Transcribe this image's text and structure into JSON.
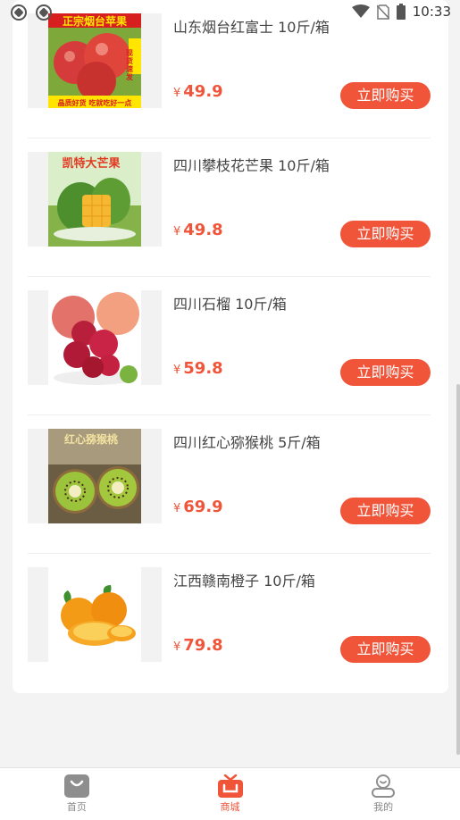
{
  "status_bar": {
    "time": "10:33",
    "icons": [
      "app-notification-icon",
      "app-notification-icon",
      "wifi-icon",
      "no-sim-icon",
      "battery-icon"
    ]
  },
  "colors": {
    "accent": "#f0553a",
    "card_bg": "#ffffff",
    "page_bg": "#f3f3f3"
  },
  "products": [
    {
      "title": "山东烟台红富士 10斤/箱",
      "currency": "¥",
      "price": "49.9",
      "buy_label": "立即购买",
      "image": {
        "banner": "正宗烟台苹果",
        "side": "现货速发",
        "footer": "晶质好货 吃就吃好一点"
      }
    },
    {
      "title": "四川攀枝花芒果 10斤/箱",
      "currency": "¥",
      "price": "49.8",
      "buy_label": "立即购买",
      "image": {
        "banner": "凯特大芒果"
      }
    },
    {
      "title": "四川石榴 10斤/箱",
      "currency": "¥",
      "price": "59.8",
      "buy_label": "立即购买",
      "image": {}
    },
    {
      "title": "四川红心猕猴桃 5斤/箱",
      "currency": "¥",
      "price": "69.9",
      "buy_label": "立即购买",
      "image": {
        "banner": "红心猕猴桃"
      }
    },
    {
      "title": "江西赣南橙子 10斤/箱",
      "currency": "¥",
      "price": "79.8",
      "buy_label": "立即购买",
      "image": {}
    }
  ],
  "bottom_nav": [
    {
      "label": "首页",
      "icon": "home-bag-icon",
      "active": false
    },
    {
      "label": "商城",
      "icon": "mall-tv-icon",
      "active": true
    },
    {
      "label": "我的",
      "icon": "profile-icon",
      "active": false
    }
  ]
}
